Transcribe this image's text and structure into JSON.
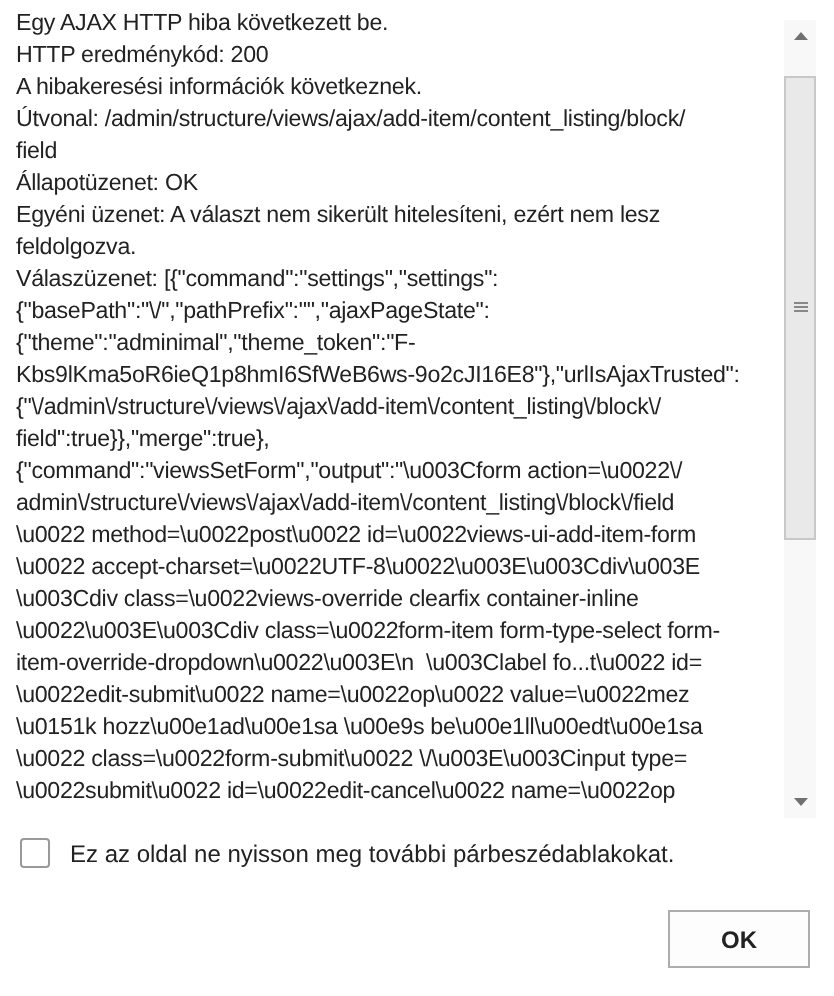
{
  "message": {
    "lines": [
      "Egy AJAX HTTP hiba következett be.",
      "HTTP eredménykód: 200",
      "A hibakeresési információk következnek.",
      "Útvonal: /admin/structure/views/ajax/add-item/content_listing/block/",
      "field",
      "Állapotüzenet: OK",
      "Egyéni üzenet: A választ nem sikerült hitelesíteni, ezért nem lesz",
      "feldolgozva.",
      "Válaszüzenet: [{\"command\":\"settings\",\"settings\":",
      "{\"basePath\":\"\\/\",\"pathPrefix\":\"\",\"ajaxPageState\":",
      "{\"theme\":\"adminimal\",\"theme_token\":\"F-",
      "Kbs9lKma5oR6ieQ1p8hmI6SfWeB6ws-9o2cJI16E8\"},\"urlIsAjaxTrusted\":",
      "{\"\\/admin\\/structure\\/views\\/ajax\\/add-item\\/content_listing\\/block\\/",
      "field\":true}},\"merge\":true},",
      "{\"command\":\"viewsSetForm\",\"output\":\"\\u003Cform action=\\u0022\\/",
      "admin\\/structure\\/views\\/ajax\\/add-item\\/content_listing\\/block\\/field",
      "\\u0022 method=\\u0022post\\u0022 id=\\u0022views-ui-add-item-form",
      "\\u0022 accept-charset=\\u0022UTF-8\\u0022\\u003E\\u003Cdiv\\u003E",
      "\\u003Cdiv class=\\u0022views-override clearfix container-inline",
      "\\u0022\\u003E\\u003Cdiv class=\\u0022form-item form-type-select form-",
      "item-override-dropdown\\u0022\\u003E\\n  \\u003Clabel fo...t\\u0022 id=",
      "\\u0022edit-submit\\u0022 name=\\u0022op\\u0022 value=\\u0022mez",
      "\\u0151k hozz\\u00e1ad\\u00e1sa \\u00e9s be\\u00e1ll\\u00edt\\u00e1sa",
      "\\u0022 class=\\u0022form-submit\\u0022 \\/\\u003E\\u003Cinput type=",
      "\\u0022submit\\u0022 id=\\u0022edit-cancel\\u0022 name=\\u0022op"
    ]
  },
  "suppress": {
    "label": "Ez az oldal ne nyisson meg további párbeszédablakokat.",
    "checked": false
  },
  "buttons": [
    "OK"
  ]
}
